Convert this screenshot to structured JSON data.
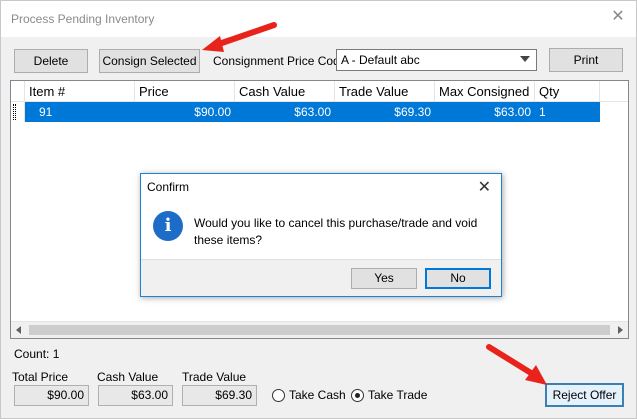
{
  "window": {
    "title": "Process Pending Inventory"
  },
  "toolbar": {
    "delete_label": "Delete",
    "consign_label": "Consign Selected",
    "price_code_label": "Consignment Price Code",
    "price_code_value": "A - Default  abc",
    "print_label": "Print"
  },
  "grid": {
    "columns": [
      "Item #",
      "Price",
      "Cash Value",
      "Trade Value",
      "Max Consigned",
      "Qty"
    ],
    "rows": [
      {
        "item": "91",
        "price": "$90.00",
        "cash": "$63.00",
        "trade": "$69.30",
        "max": "$63.00",
        "qty": "1"
      }
    ]
  },
  "footer": {
    "count_text": "Count: 1",
    "total_price_label": "Total Price",
    "total_price": "$90.00",
    "cash_value_label": "Cash Value",
    "cash_value": "$63.00",
    "trade_value_label": "Trade Value",
    "trade_value": "$69.30",
    "take_cash_label": "Take Cash",
    "take_trade_label": "Take Trade",
    "take_trade_selected": true,
    "reject_label": "Reject Offer"
  },
  "dialog": {
    "title": "Confirm",
    "message": "Would you like to cancel this purchase/trade and void these items?",
    "yes_label": "Yes",
    "no_label": "No",
    "icon": "info-icon"
  },
  "colors": {
    "selection": "#0078d7",
    "annotation_arrow": "#e8231b",
    "info_icon": "#1c6cc8"
  }
}
